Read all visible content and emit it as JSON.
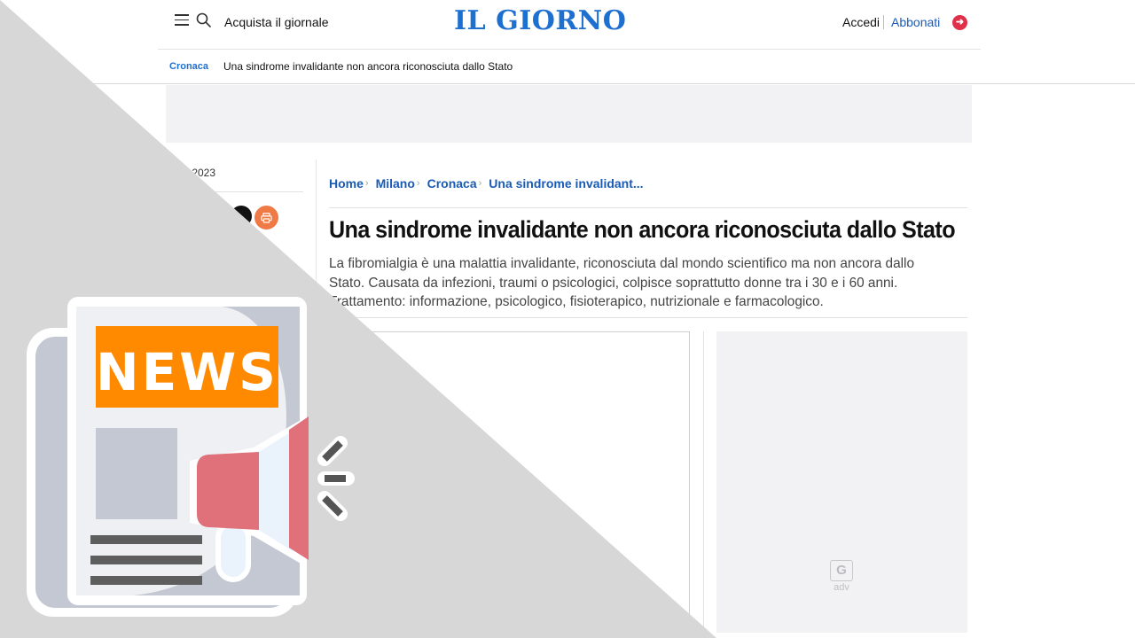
{
  "header": {
    "buy_label": "Acquista il giornale",
    "logo_text": "IL GIORNO",
    "login_label": "Accedi",
    "subscribe_label": "Abbonati"
  },
  "section_bar": {
    "section": "Cronaca",
    "title": "Una sindrome invalidante non ancora riconosciuta dallo Stato"
  },
  "breadcrumb": [
    "Home",
    "Milano",
    "Cronaca",
    "Una sindrome invalidant..."
  ],
  "article": {
    "date_partial": "y 2023",
    "headline": "Una sindrome invalidante non ancora riconosciuta dallo Stato",
    "summary": "La fibromialgia è una malattia invalidante, riconosciuta dal mondo scientifico ma non ancora dallo Stato. Causata da infezioni, traumi o psicologici, colpisce soprattutto donne tra i 30 e i 60 anni. Trattamento: informazione, psicologico, fisioterapico, nutrizionale e farmacologico."
  },
  "side_ad": {
    "badge": "G",
    "label": "adv"
  },
  "overlay": {
    "badge_text": "NEWS"
  },
  "colors": {
    "brand_blue": "#1d6fd0",
    "link_blue": "#1a5bb5",
    "subscribe_red": "#e0304a",
    "print_orange": "#f07a45",
    "overlay_gray": "#d7d7d7",
    "news_orange": "#ff8a00",
    "megaphone_red": "#e07079"
  },
  "icons": [
    "menu-icon",
    "search-icon",
    "arrow-right-icon",
    "share-icon",
    "print-icon",
    "newspaper-icon",
    "megaphone-icon"
  ]
}
